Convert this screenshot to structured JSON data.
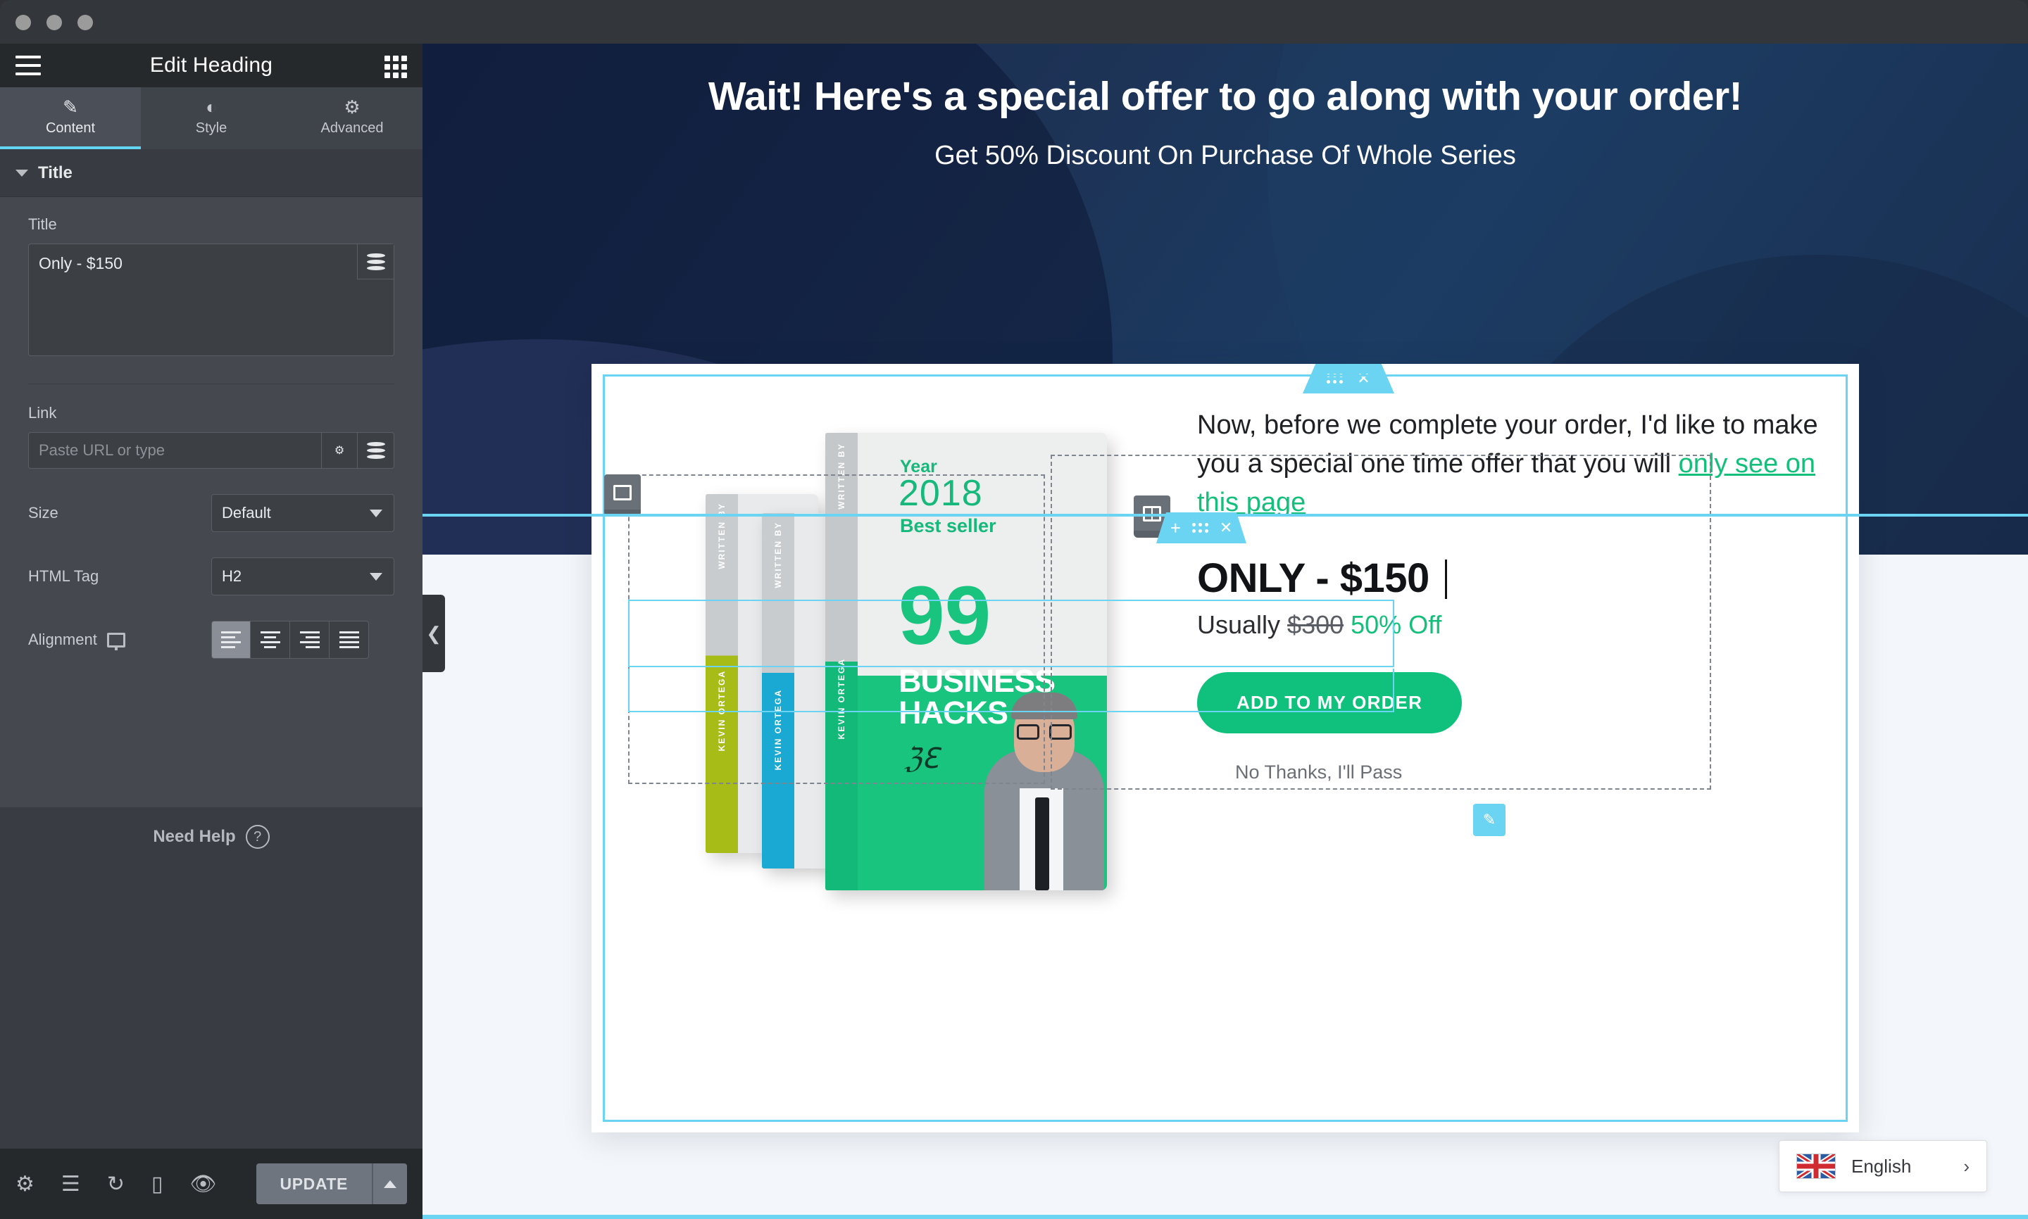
{
  "window": {
    "dots": 3
  },
  "panel": {
    "title": "Edit Heading",
    "menu_icon": "hamburger-icon",
    "widgets_icon": "grid-icon",
    "tabs": [
      {
        "label": "Content",
        "icon": "pencil-icon",
        "active": true
      },
      {
        "label": "Style",
        "icon": "contrast-icon",
        "active": false
      },
      {
        "label": "Advanced",
        "icon": "gear-icon",
        "active": false
      }
    ],
    "section": {
      "label": "Title",
      "expanded": true
    },
    "fields": {
      "title_label": "Title",
      "title_value": "Only - $150",
      "link_label": "Link",
      "link_placeholder": "Paste URL or type",
      "link_value": "",
      "size_label": "Size",
      "size_value": "Default",
      "htmltag_label": "HTML Tag",
      "htmltag_value": "H2",
      "alignment_label": "Alignment",
      "alignment_selected": "left",
      "alignment_options": [
        "left",
        "center",
        "right",
        "justify"
      ]
    },
    "help": {
      "label": "Need Help",
      "icon": "question-circle-icon"
    },
    "footer": {
      "icons": [
        "gear-icon",
        "layers-icon",
        "history-icon",
        "responsive-icon",
        "preview-icon"
      ],
      "update_label": "UPDATE",
      "update_dropdown_icon": "chevron-up-icon"
    },
    "collapse_icon": "chevron-left-icon"
  },
  "canvas": {
    "hero": {
      "headline": "Wait! Here's a special offer to go along with your order!",
      "subheadline": "Get 50% Discount On Purchase Of Whole Series"
    },
    "section_handle": {
      "drag_icon": "drag-dots-icon",
      "close_icon": "close-icon"
    },
    "widget_handle": {
      "add_icon": "plus-icon",
      "drag_icon": "drag-dots-icon",
      "close_icon": "close-icon"
    },
    "column_handle_icon": "column-icon",
    "edit_pencil_icon": "pencil-icon",
    "book": {
      "year_label": "Year",
      "year": "2018",
      "best_seller": "Best seller",
      "number": "99",
      "title_line1": "BUSINESS",
      "title_line2": "HACKS",
      "spine_written_by": "WRITTEN BY",
      "spine_author": "KEVIN ORTEGA"
    },
    "offer": {
      "paragraph_part1": "Now, before we complete your order, I'd like to make you a special one time offer that you will ",
      "paragraph_link": "only see on this page",
      "price_main": "ONLY - $150",
      "price_usually_label": "Usually ",
      "price_old": "$300",
      "price_discount": " 50% Off",
      "cta_label": "ADD TO MY ORDER",
      "decline_label": "No Thanks, I'll Pass"
    },
    "language": {
      "label": "English",
      "flag": "uk-flag-icon",
      "chevron": "chevron-right-icon"
    }
  },
  "colors": {
    "accent_cyan": "#6cd4f3",
    "green": "#0fc17c",
    "panel_bg": "#45494f",
    "panel_dark": "#26292c",
    "hero_navy": "#18264a"
  }
}
